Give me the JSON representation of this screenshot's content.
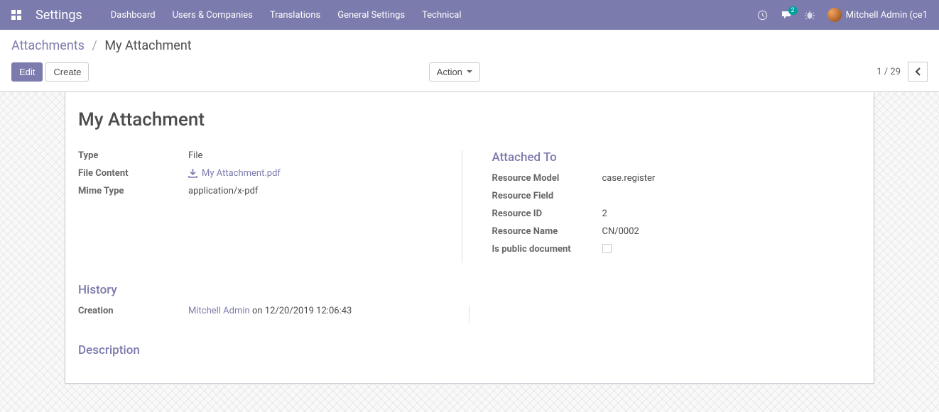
{
  "nav": {
    "app_title": "Settings",
    "links": [
      "Dashboard",
      "Users & Companies",
      "Translations",
      "General Settings",
      "Technical"
    ],
    "chat_badge": "2",
    "user_name": "Mitchell Admin (ce1"
  },
  "breadcrumb": {
    "parent": "Attachments",
    "current": "My Attachment"
  },
  "buttons": {
    "edit": "Edit",
    "create": "Create",
    "action": "Action"
  },
  "pager": {
    "text": "1 / 29"
  },
  "form": {
    "title": "My Attachment",
    "left": {
      "type_label": "Type",
      "type_value": "File",
      "file_content_label": "File Content",
      "file_content_value": "My Attachment.pdf",
      "mime_type_label": "Mime Type",
      "mime_type_value": "application/x-pdf"
    },
    "right": {
      "section_title": "Attached To",
      "resource_model_label": "Resource Model",
      "resource_model_value": "case.register",
      "resource_field_label": "Resource Field",
      "resource_field_value": "",
      "resource_id_label": "Resource ID",
      "resource_id_value": "2",
      "resource_name_label": "Resource Name",
      "resource_name_value": "CN/0002",
      "is_public_label": "Is public document"
    },
    "history": {
      "section_title": "History",
      "creation_label": "Creation",
      "creation_user": "Mitchell Admin",
      "creation_suffix": " on 12/20/2019 12:06:43"
    },
    "description": {
      "section_title": "Description"
    }
  }
}
